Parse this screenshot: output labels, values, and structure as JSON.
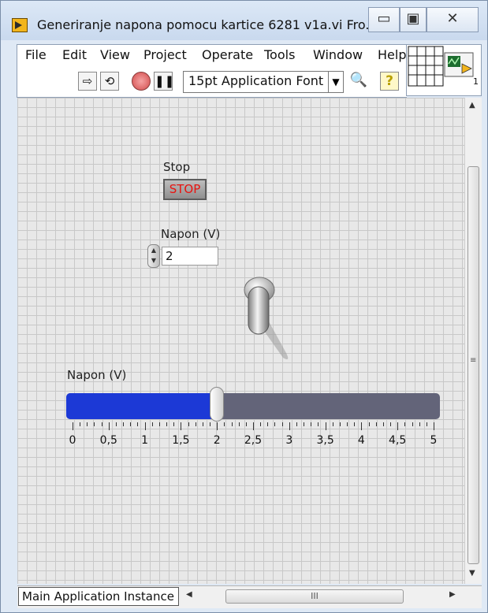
{
  "window": {
    "title": "Generiranje napona pomocu kartice 6281 v1a.vi Fro...",
    "buttons": {
      "minimize": "▭",
      "maximize": "▣",
      "close": "✕"
    }
  },
  "menu": [
    "File",
    "Edit",
    "View",
    "Project",
    "Operate",
    "Tools",
    "Window",
    "Help"
  ],
  "toolbar": {
    "run_icon": "run-arrow-icon",
    "run_continuous_icon": "run-continuously-icon",
    "abort_icon": "abort-icon",
    "pause_icon": "pause-icon",
    "font": "15pt Application Font",
    "search_icon": "search-icon",
    "help_icon": "help-icon"
  },
  "front_panel": {
    "stop_label": "Stop",
    "stop_button": "STOP",
    "numeric_label": "Napon (V)",
    "numeric_value": "2",
    "slider_label": "Napon (V)",
    "slider": {
      "min": 0,
      "max": 5,
      "value": 2
    },
    "scale_labels": [
      "0",
      "0,5",
      "1",
      "1,5",
      "2",
      "2,5",
      "3",
      "3,5",
      "4",
      "4,5",
      "5"
    ]
  },
  "status_bar": {
    "context": "Main Application Instance",
    "scroll_grip": "III"
  },
  "colors": {
    "slider_fill": "#1c39d6",
    "slider_track": "#636479",
    "stop_text": "#e8130f"
  }
}
